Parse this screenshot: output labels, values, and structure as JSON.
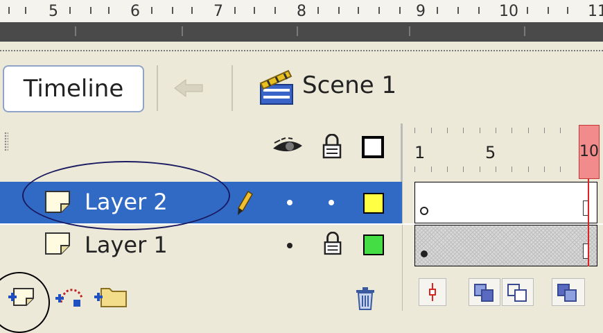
{
  "ruler": {
    "numbers": [
      "5",
      "6",
      "7",
      "8",
      "9",
      "10",
      "11"
    ]
  },
  "toolbar": {
    "timeline_label": "Timeline",
    "scene_label": "Scene 1"
  },
  "frames_ruler": {
    "numbers": [
      "1",
      "5",
      "10"
    ]
  },
  "layers": [
    {
      "name": "Layer 2",
      "selected": true,
      "swatch_color": "#ffff44",
      "keyframe": "empty"
    },
    {
      "name": "Layer 1",
      "selected": false,
      "swatch_color": "#44dd44",
      "keyframe": "filled"
    }
  ],
  "colors": {
    "selection": "#316ac5",
    "playhead": "#f28c8c"
  },
  "icons": [
    "eye-icon",
    "lock-icon",
    "outline-icon",
    "pencil-icon",
    "layer-icon",
    "insert-layer-icon",
    "add-motion-guide-icon",
    "insert-folder-icon",
    "trash-icon",
    "center-frame-icon",
    "onion-skin-icon",
    "onion-skin-outlines-icon",
    "edit-multiple-frames-icon"
  ]
}
